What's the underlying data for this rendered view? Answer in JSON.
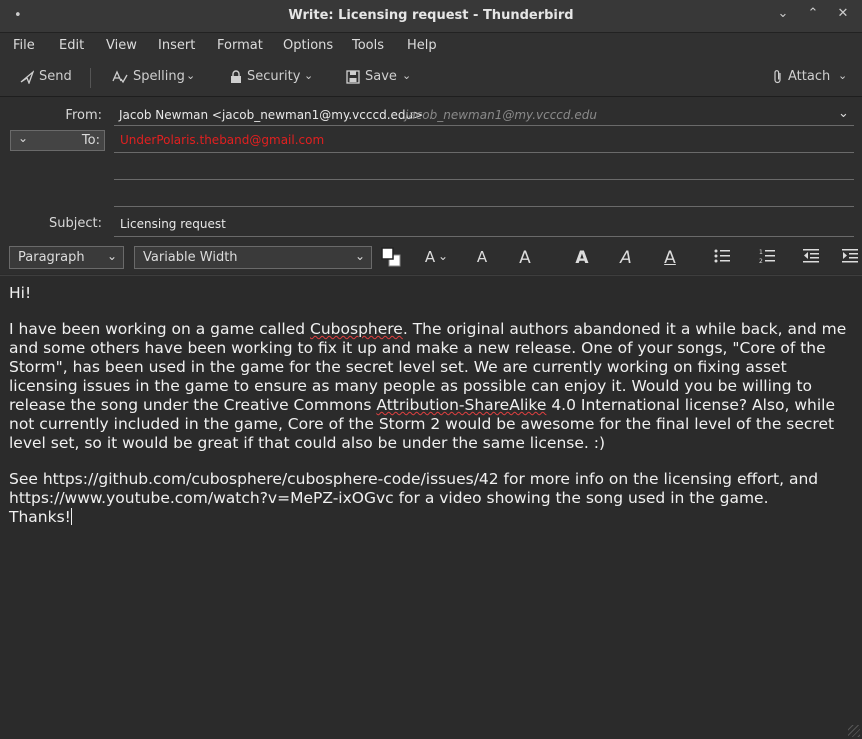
{
  "window": {
    "title": "Write: Licensing request - Thunderbird",
    "menu_glyph": "•",
    "minimize": "⌄",
    "maximize": "⌃",
    "close": "✕"
  },
  "menu": [
    "File",
    "Edit",
    "View",
    "Insert",
    "Format",
    "Options",
    "Tools",
    "Help"
  ],
  "toolbar": {
    "send": "Send",
    "spelling": "Spelling",
    "security": "Security",
    "save": "Save",
    "attach": "Attach"
  },
  "header": {
    "from_label": "From:",
    "from_value": "Jacob Newman <jacob_newman1@my.vcccd.edu>",
    "from_hint": "jacob_newman1@my.vcccd.edu",
    "to_label": "To:",
    "to_value": "UnderPolaris.theband@gmail.com",
    "subject_label": "Subject:",
    "subject_value": "Licensing request"
  },
  "format": {
    "paragraph": "Paragraph",
    "font": "Variable Width"
  },
  "body": {
    "greeting": "Hi!",
    "p1_a": "I have been working on a game called ",
    "p1_word1": "Cubosphere",
    "p1_b": ". The original authors abandoned it a while back, and me and some others have been working to fix it up and make a new release. One of your songs, \"Core of the Storm\", has been used in the game for the secret level set. We are currently working on fixing asset licensing issues in the game to ensure as many people as possible can enjoy it. Would you be willing to release the song under the Creative Commons ",
    "p1_word2": "Attribution-ShareAlike",
    "p1_c": " 4.0 International license?  Also, while not currently included in the game, Core of the Storm 2 would be awesome for the final level of the secret level set, so it would be great if that could also be under the same license. :)",
    "p2": "See https://github.com/cubosphere/cubosphere-code/issues/42 for more info on the licensing effort, and https://www.youtube.com/watch?v=MePZ-ixOGvc for a video showing the song used in the game.",
    "p3": "Thanks!"
  },
  "colors": {
    "recipient": "#e02020",
    "hint": "#8a8a8a"
  }
}
